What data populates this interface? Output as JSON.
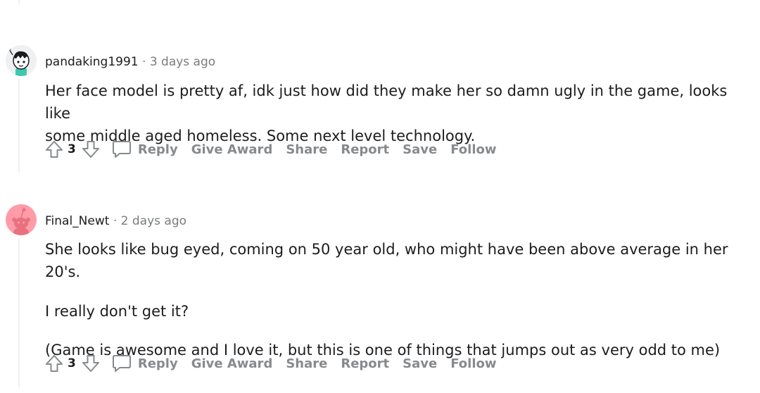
{
  "comments": [
    {
      "username": "pandaking1991",
      "separator": "·",
      "time": "3 days ago",
      "paragraphs": [
        "Her face model is pretty af, idk just how did they make her so damn ugly in the game, looks like",
        "some middle aged homeless. Some next level technology."
      ],
      "score": "3",
      "actions": {
        "reply": "Reply",
        "give_award": "Give Award",
        "share": "Share",
        "report": "Report",
        "save": "Save",
        "follow": "Follow"
      }
    },
    {
      "username": "Final_Newt",
      "separator": "·",
      "time": "2 days ago",
      "paragraphs": [
        "She looks like bug eyed, coming on 50 year old, who might have been above average in her 20's.",
        "I really don't get it?",
        "(Game is awesome and I love it, but this is one of things that jumps out as very odd to me)"
      ],
      "score": "3",
      "actions": {
        "reply": "Reply",
        "give_award": "Give Award",
        "share": "Share",
        "report": "Report",
        "save": "Save",
        "follow": "Follow"
      }
    }
  ],
  "colors": {
    "meta_gray": "#787c7e",
    "action_gray": "#878a8c",
    "thread_line": "#edeff1",
    "avatar_pink": "#ff9ca7",
    "avatar_teal": "#3ec6b0"
  },
  "icons": [
    "upvote-icon",
    "downvote-icon",
    "comment-bubble-icon",
    "reddit-snoo-avatar",
    "custom-avatar"
  ]
}
